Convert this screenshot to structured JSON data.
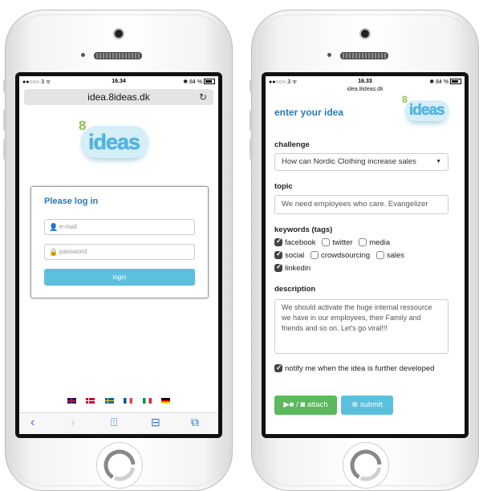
{
  "left_phone": {
    "status": {
      "carrier": "●●○○○ 3 ᯤ",
      "time": "16.34",
      "battery": "✱ 84 %"
    },
    "url": "idea.8ideas.dk",
    "reload_icon": "reload-icon",
    "logo": {
      "eight": "8",
      "word": "ideas"
    },
    "login": {
      "title": "Please log in",
      "email_placeholder": "e-mail",
      "password_placeholder": "password",
      "button": "login"
    },
    "flags": [
      "uk-flag",
      "denmark-flag",
      "sweden-flag",
      "france-flag",
      "italy-flag",
      "germany-flag"
    ],
    "toolbar": {
      "back": "‹",
      "forward": "›",
      "share": "⍐",
      "bookmarks": "⊟",
      "tabs": "⧉"
    }
  },
  "right_phone": {
    "status": {
      "carrier": "●●○○○ 3 ᯤ",
      "time": "16.33",
      "battery": "✱ 84 %"
    },
    "url": "idea.8ideas.dk",
    "title": "enter your idea",
    "logo": {
      "eight": "8",
      "word": "ideas"
    },
    "challenge": {
      "label": "challenge",
      "selected": "How can Nordic Clothing increase sales"
    },
    "topic": {
      "label": "topic",
      "value": "We need employees who care. Evangelizer"
    },
    "keywords": {
      "label": "keywords (tags)",
      "tags": [
        {
          "name": "facebook",
          "checked": true
        },
        {
          "name": "twitter",
          "checked": false
        },
        {
          "name": "media",
          "checked": false
        },
        {
          "name": "social",
          "checked": true
        },
        {
          "name": "crowdsourcing",
          "checked": false
        },
        {
          "name": "sales",
          "checked": false
        },
        {
          "name": "linkedin",
          "checked": true
        }
      ]
    },
    "description": {
      "label": "description",
      "value": "We should activate the huge internal ressource we have in our employees, their Family and friends and so on. Let's go viral!!!"
    },
    "notify": {
      "checked": true,
      "label": "notify me when the idea is further developed"
    },
    "buttons": {
      "attach": "attach",
      "submit": "submit"
    }
  },
  "colors": {
    "accent_blue": "#2a7ab6",
    "info_button": "#5bc0de",
    "success_button": "#5cb85c",
    "logo_blue": "#4fb5e0"
  }
}
